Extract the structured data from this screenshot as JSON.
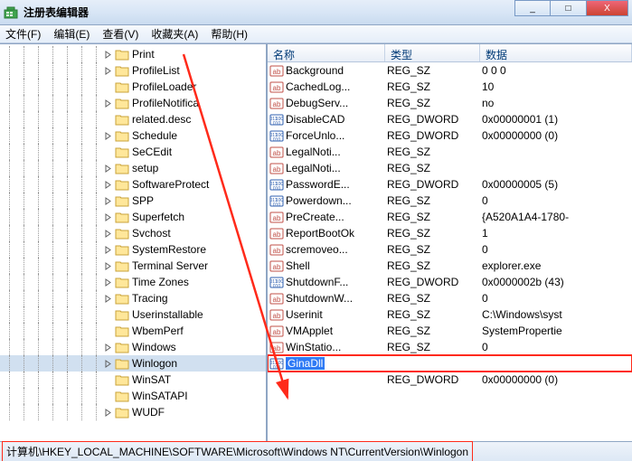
{
  "window": {
    "title": "注册表编辑器",
    "minimize_tip": "_",
    "maximize_tip": "□",
    "close_tip": "X"
  },
  "menu": {
    "file": "文件(F)",
    "edit": "编辑(E)",
    "view": "查看(V)",
    "favorites": "收藏夹(A)",
    "help": "帮助(H)"
  },
  "tree": {
    "items": [
      {
        "label": "Print",
        "expander": "right"
      },
      {
        "label": "ProfileList",
        "expander": "right"
      },
      {
        "label": "ProfileLoader",
        "expander": "none"
      },
      {
        "label": "ProfileNotifica",
        "expander": "right"
      },
      {
        "label": "related.desc",
        "expander": "none"
      },
      {
        "label": "Schedule",
        "expander": "right"
      },
      {
        "label": "SeCEdit",
        "expander": "none"
      },
      {
        "label": "setup",
        "expander": "right"
      },
      {
        "label": "SoftwareProtect",
        "expander": "right"
      },
      {
        "label": "SPP",
        "expander": "right"
      },
      {
        "label": "Superfetch",
        "expander": "right"
      },
      {
        "label": "Svchost",
        "expander": "right"
      },
      {
        "label": "SystemRestore",
        "expander": "right"
      },
      {
        "label": "Terminal Server",
        "expander": "right"
      },
      {
        "label": "Time Zones",
        "expander": "right"
      },
      {
        "label": "Tracing",
        "expander": "right"
      },
      {
        "label": "Userinstallable",
        "expander": "none"
      },
      {
        "label": "WbemPerf",
        "expander": "none"
      },
      {
        "label": "Windows",
        "expander": "right"
      },
      {
        "label": "Winlogon",
        "expander": "right",
        "selected": true
      },
      {
        "label": "WinSAT",
        "expander": "none"
      },
      {
        "label": "WinSATAPI",
        "expander": "none"
      },
      {
        "label": "WUDF",
        "expander": "right"
      }
    ]
  },
  "list": {
    "headers": {
      "name": "名称",
      "type": "类型",
      "data": "数据"
    },
    "rows": [
      {
        "icon": "sz",
        "name": "Background",
        "type": "REG_SZ",
        "data": "0 0 0"
      },
      {
        "icon": "sz",
        "name": "CachedLog...",
        "type": "REG_SZ",
        "data": "10"
      },
      {
        "icon": "sz",
        "name": "DebugServ...",
        "type": "REG_SZ",
        "data": "no"
      },
      {
        "icon": "dw",
        "name": "DisableCAD",
        "type": "REG_DWORD",
        "data": "0x00000001 (1)"
      },
      {
        "icon": "dw",
        "name": "ForceUnlo...",
        "type": "REG_DWORD",
        "data": "0x00000000 (0)"
      },
      {
        "icon": "sz",
        "name": "LegalNoti...",
        "type": "REG_SZ",
        "data": ""
      },
      {
        "icon": "sz",
        "name": "LegalNoti...",
        "type": "REG_SZ",
        "data": ""
      },
      {
        "icon": "dw",
        "name": "PasswordE...",
        "type": "REG_DWORD",
        "data": "0x00000005 (5)"
      },
      {
        "icon": "dw",
        "name": "Powerdown...",
        "type": "REG_SZ",
        "data": "0"
      },
      {
        "icon": "sz",
        "name": "PreCreate...",
        "type": "REG_SZ",
        "data": "{A520A1A4-1780-"
      },
      {
        "icon": "sz",
        "name": "ReportBootOk",
        "type": "REG_SZ",
        "data": "1"
      },
      {
        "icon": "sz",
        "name": "scremoveo...",
        "type": "REG_SZ",
        "data": "0"
      },
      {
        "icon": "sz",
        "name": "Shell",
        "type": "REG_SZ",
        "data": "explorer.exe"
      },
      {
        "icon": "dw",
        "name": "ShutdownF...",
        "type": "REG_DWORD",
        "data": "0x0000002b (43)"
      },
      {
        "icon": "sz",
        "name": "ShutdownW...",
        "type": "REG_SZ",
        "data": "0"
      },
      {
        "icon": "sz",
        "name": "Userinit",
        "type": "REG_SZ",
        "data": "C:\\Windows\\syst"
      },
      {
        "icon": "sz",
        "name": "VMApplet",
        "type": "REG_SZ",
        "data": "SystemPropertie"
      },
      {
        "icon": "sz",
        "name": "WinStatio...",
        "type": "REG_SZ",
        "data": "0"
      },
      {
        "icon": "dw",
        "name": "GinaDll",
        "type": "",
        "data": "",
        "selected": true,
        "highlighted": true
      },
      {
        "icon": "none",
        "name": "",
        "type": "REG_DWORD",
        "data": "0x00000000 (0)"
      }
    ]
  },
  "statusbar": {
    "path": "计算机\\HKEY_LOCAL_MACHINE\\SOFTWARE\\Microsoft\\Windows NT\\CurrentVersion\\Winlogon"
  },
  "colors": {
    "red": "#ff2a1a",
    "selection": "#2f7af5"
  }
}
